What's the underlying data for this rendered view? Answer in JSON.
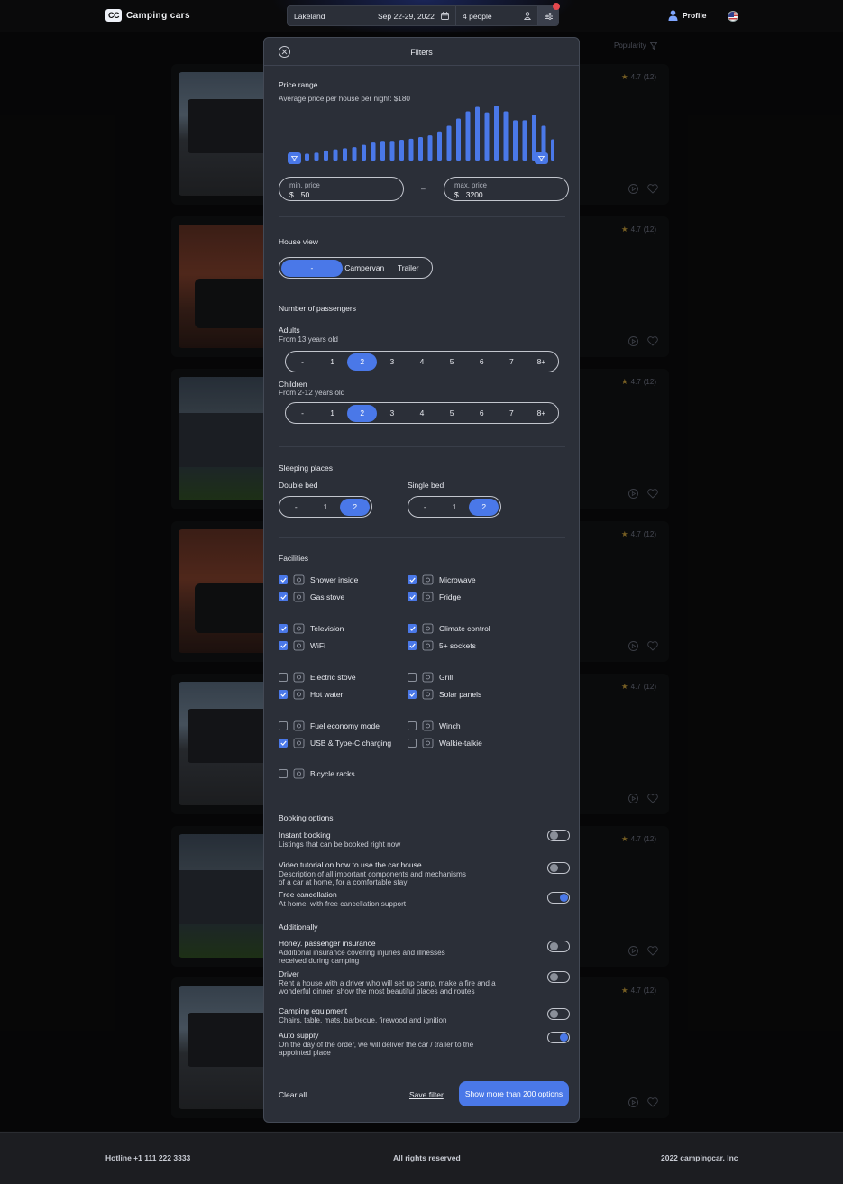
{
  "app": {
    "logo_mark": "CC",
    "name": "Camping cars"
  },
  "search": {
    "location": "Lakeland",
    "dates": "Sep 22-29, 2022",
    "people": "4 people"
  },
  "nav": {
    "profile": "Profile"
  },
  "listing": {
    "sort_label": "Popularity",
    "rating": "4.7",
    "reviews": "(12)"
  },
  "footer": {
    "hotline": "Hotline +1 111 222 3333",
    "rights": "All rights reserved",
    "company": "2022 campingcar. Inc"
  },
  "filters": {
    "title": "Filters",
    "price": {
      "title": "Price range",
      "average": "Average price per house per night: $180",
      "histogram": [
        0.12,
        0.14,
        0.18,
        0.2,
        0.22,
        0.24,
        0.28,
        0.32,
        0.35,
        0.35,
        0.37,
        0.39,
        0.42,
        0.45,
        0.52,
        0.62,
        0.75,
        0.88,
        0.96,
        0.86,
        0.98,
        0.88,
        0.72,
        0.72,
        0.82,
        0.62,
        0.38
      ],
      "min_label": "min. price",
      "min_currency": "$",
      "min_value": "50",
      "max_label": "max. price",
      "max_currency": "$",
      "max_value": "3200",
      "separator": "–"
    },
    "house_view": {
      "title": "House view",
      "options": [
        "-",
        "Campervan",
        "Trailer"
      ],
      "selected": 0
    },
    "passengers": {
      "title": "Number of passengers",
      "adults_label": "Adults",
      "adults_sub": "From 13 years old",
      "children_label": "Children",
      "children_sub": "From 2-12 years old",
      "options": [
        "-",
        "1",
        "2",
        "3",
        "4",
        "5",
        "6",
        "7",
        "8+"
      ],
      "adults_selected": 2,
      "children_selected": 2
    },
    "sleeping": {
      "title": "Sleeping places",
      "double_label": "Double bed",
      "single_label": "Single bed",
      "options": [
        "-",
        "1",
        "2"
      ],
      "double_selected": 2,
      "single_selected": 2
    },
    "facilities": {
      "title": "Facilities",
      "items": [
        {
          "label": "Shower inside",
          "checked": true,
          "icon": "shower-icon"
        },
        {
          "label": "Microwave",
          "checked": true,
          "icon": "microwave-icon"
        },
        {
          "label": "Gas stove",
          "checked": true,
          "icon": "gas-stove-icon"
        },
        {
          "label": "Fridge",
          "checked": true,
          "icon": "fridge-icon"
        },
        {
          "label": "Television",
          "checked": true,
          "icon": "television-icon"
        },
        {
          "label": "Climate control",
          "checked": true,
          "icon": "climate-control-icon"
        },
        {
          "label": "WiFi",
          "checked": true,
          "icon": "wifi-icon"
        },
        {
          "label": "5+ sockets",
          "checked": true,
          "icon": "socket-icon"
        },
        {
          "label": "Electric stove",
          "checked": false,
          "icon": "electric-stove-icon"
        },
        {
          "label": "Grill",
          "checked": false,
          "icon": "grill-icon"
        },
        {
          "label": "Hot water",
          "checked": true,
          "icon": "hot-water-icon"
        },
        {
          "label": "Solar panels",
          "checked": true,
          "icon": "solar-panel-icon"
        },
        {
          "label": "Fuel economy mode",
          "checked": false,
          "icon": "fuel-economy-icon"
        },
        {
          "label": "Winch",
          "checked": false,
          "icon": "winch-icon"
        },
        {
          "label": "USB & Type-C charging",
          "checked": true,
          "icon": "usb-icon"
        },
        {
          "label": "Walkie-talkie",
          "checked": false,
          "icon": "walkie-talkie-icon"
        },
        {
          "label": "Bicycle racks",
          "checked": false,
          "icon": "bicycle-rack-icon"
        }
      ]
    },
    "booking": {
      "title": "Booking options",
      "options": [
        {
          "title": "Instant booking",
          "desc": "Listings that can be booked right now",
          "on": false
        },
        {
          "title": "Video tutorial on how to use the car house",
          "desc": "Description of all important components and mechanisms of a car at home, for a comfortable stay",
          "on": false
        },
        {
          "title": "Free cancellation",
          "desc": "At home, with free cancellation support",
          "on": true
        }
      ]
    },
    "additionally": {
      "title": "Additionally",
      "options": [
        {
          "title": "Honey. passenger insurance",
          "desc": "Additional insurance covering injuries and illnesses received during camping",
          "on": false
        },
        {
          "title": "Driver",
          "desc": "Rent a house with a driver who will set up camp, make a fire and a wonderful dinner, show the most beautiful places and routes",
          "on": false
        },
        {
          "title": "Camping equipment",
          "desc": "Chairs, table, mats, barbecue, firewood and ignition",
          "on": false
        },
        {
          "title": "Auto supply",
          "desc": "On the day of the order, we will deliver the car / trailer to the appointed place",
          "on": true
        }
      ]
    },
    "actions": {
      "clear": "Clear all",
      "save": "Save filter",
      "show": "Show more than 200 options"
    }
  },
  "colors": {
    "accent": "#4a78e8",
    "panel": "#2b2f38",
    "background": "#0a0a0b"
  }
}
